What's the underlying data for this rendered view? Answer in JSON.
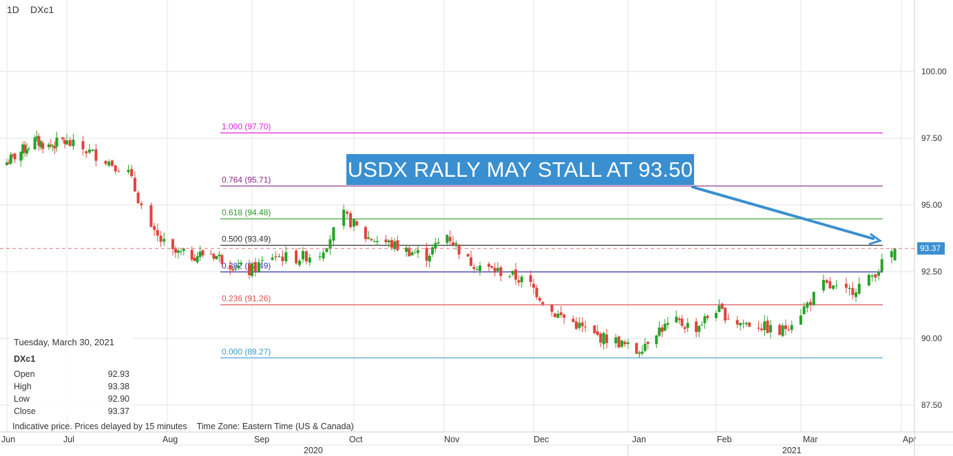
{
  "header": {
    "interval": "1D",
    "symbol": "DXc1"
  },
  "annotation": {
    "text": "USDX RALLY MAY STALL AT 93.50"
  },
  "info_panel": {
    "date": "Tuesday, March 30, 2021",
    "symbol": "DXc1",
    "rows": [
      {
        "label": "Open",
        "value": "92.93"
      },
      {
        "label": "High",
        "value": "93.38"
      },
      {
        "label": "Low",
        "value": "92.90"
      },
      {
        "label": "Close",
        "value": "93.37"
      }
    ]
  },
  "footer": {
    "note": "Indicative price. Prices delayed by 15 minutes",
    "timezone": "Time Zone: Eastern Time (US & Canada)"
  },
  "colors": {
    "up": "#27a327",
    "down": "#e0443c",
    "fib_100": "#e020e0",
    "fib_764": "#8a2a8a",
    "fib_618": "#2a9a2a",
    "fib_500": "#333333",
    "fib_382": "#3333aa",
    "fib_236": "#e05050",
    "fib_000": "#3a9ad0",
    "arrow": "#3a8fd0",
    "last_price": "#3a8fd0"
  },
  "chart_data": {
    "type": "candlestick",
    "y_axis": {
      "ticks": [
        "100.00",
        "97.50",
        "95.00",
        "92.50",
        "90.00",
        "87.50"
      ],
      "side": "right"
    },
    "x_axis": {
      "months": [
        "Jun",
        "Jul",
        "Aug",
        "Sep",
        "Oct",
        "Nov",
        "Dec",
        "Jan",
        "Feb",
        "Mar",
        "Apr"
      ],
      "years": [
        "2020",
        "2021"
      ]
    },
    "last_price": "93.37",
    "fibonacci": [
      {
        "ratio": "1.000",
        "price": 97.7,
        "label": "1.000 (97.70)",
        "color": "#e020e0"
      },
      {
        "ratio": "0.764",
        "price": 95.71,
        "label": "0.764 (95.71)",
        "color": "#8a2a8a"
      },
      {
        "ratio": "0.618",
        "price": 94.48,
        "label": "0.618 (94.48)",
        "color": "#2a9a2a"
      },
      {
        "ratio": "0.500",
        "price": 93.49,
        "label": "0.500 (93.49)",
        "color": "#333333"
      },
      {
        "ratio": "0.382",
        "price": 92.49,
        "label": "0.382 (92.49)",
        "color": "#3333aa"
      },
      {
        "ratio": "0.236",
        "price": 91.26,
        "label": "0.236 (91.26)",
        "color": "#e05050"
      },
      {
        "ratio": "0.000",
        "price": 89.27,
        "label": "0.000 (89.27)",
        "color": "#3a9ad0"
      }
    ],
    "closes_anchors": [
      [
        "2020-06-01",
        96.6
      ],
      [
        "2020-06-08",
        97.0
      ],
      [
        "2020-06-15",
        97.4
      ],
      [
        "2020-06-22",
        97.2
      ],
      [
        "2020-06-29",
        97.4
      ],
      [
        "2020-07-06",
        97.1
      ],
      [
        "2020-07-13",
        96.7
      ],
      [
        "2020-07-20",
        96.2
      ],
      [
        "2020-07-27",
        94.0
      ],
      [
        "2020-08-03",
        93.2
      ],
      [
        "2020-08-10",
        93.1
      ],
      [
        "2020-08-17",
        93.2
      ],
      [
        "2020-08-24",
        92.8
      ],
      [
        "2020-08-31",
        92.5
      ],
      [
        "2020-09-07",
        93.1
      ],
      [
        "2020-09-14",
        93.0
      ],
      [
        "2020-09-21",
        93.2
      ],
      [
        "2020-09-28",
        94.6
      ],
      [
        "2020-10-05",
        93.8
      ],
      [
        "2020-10-12",
        93.6
      ],
      [
        "2020-10-19",
        93.3
      ],
      [
        "2020-10-26",
        93.1
      ],
      [
        "2020-11-02",
        93.9
      ],
      [
        "2020-11-09",
        92.9
      ],
      [
        "2020-11-16",
        92.6
      ],
      [
        "2020-11-23",
        92.4
      ],
      [
        "2020-11-30",
        92.0
      ],
      [
        "2020-12-07",
        91.0
      ],
      [
        "2020-12-14",
        90.6
      ],
      [
        "2020-12-21",
        90.1
      ],
      [
        "2020-12-28",
        89.9
      ],
      [
        "2021-01-04",
        89.5
      ],
      [
        "2021-01-11",
        90.3
      ],
      [
        "2021-01-18",
        90.6
      ],
      [
        "2021-01-25",
        90.4
      ],
      [
        "2021-02-01",
        91.1
      ],
      [
        "2021-02-08",
        90.6
      ],
      [
        "2021-02-15",
        90.5
      ],
      [
        "2021-02-22",
        90.2
      ],
      [
        "2021-03-01",
        91.0
      ],
      [
        "2021-03-08",
        92.0
      ],
      [
        "2021-03-15",
        91.7
      ],
      [
        "2021-03-22",
        92.2
      ],
      [
        "2021-03-30",
        93.37
      ]
    ]
  }
}
